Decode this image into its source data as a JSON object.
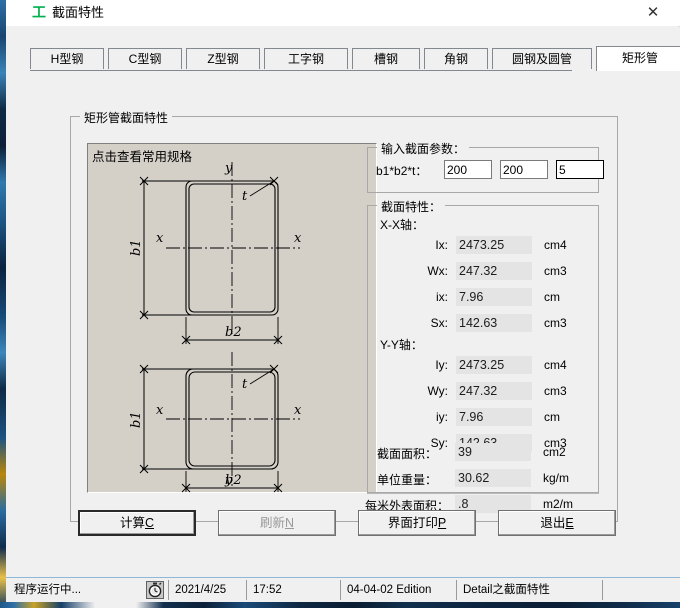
{
  "window": {
    "title": "截面特性",
    "icon": "ibeam-icon",
    "close_label": "✕"
  },
  "tabs": [
    {
      "label": "H型钢",
      "selected": false
    },
    {
      "label": "C型钢",
      "selected": false
    },
    {
      "label": "Z型钢",
      "selected": false
    },
    {
      "label": "工字钢",
      "selected": false
    },
    {
      "label": "槽钢",
      "selected": false
    },
    {
      "label": "角钢",
      "selected": false
    },
    {
      "label": "圆钢及圆管",
      "selected": false
    },
    {
      "label": "矩形管",
      "selected": true
    }
  ],
  "main_group": {
    "label": "矩形管截面特性"
  },
  "figure": {
    "hint": "点击查看常用规格",
    "labels": {
      "y": "y",
      "x": "x",
      "b1": "b1",
      "b2": "b2",
      "t": "t"
    }
  },
  "input_group": {
    "label": "输入截面参数：",
    "field_label": "b1*b2*t：",
    "fields": [
      {
        "name": "b1",
        "value": "200",
        "focused": false
      },
      {
        "name": "b2",
        "value": "200",
        "focused": false
      },
      {
        "name": "t",
        "value": "5",
        "focused": true
      }
    ]
  },
  "properties_group": {
    "label": "截面特性：",
    "xx_axis_label": "X-X轴：",
    "yy_axis_label": "Y-Y轴：",
    "xx_rows": [
      {
        "name": "Ix:",
        "value": "2473.25",
        "unit": "cm4"
      },
      {
        "name": "Wx:",
        "value": "247.32",
        "unit": "cm3"
      },
      {
        "name": "ix:",
        "value": "7.96",
        "unit": "cm"
      },
      {
        "name": "Sx:",
        "value": "142.63",
        "unit": "cm3"
      }
    ],
    "yy_rows": [
      {
        "name": "Iy:",
        "value": "2473.25",
        "unit": "cm4"
      },
      {
        "name": "Wy:",
        "value": "247.32",
        "unit": "cm3"
      },
      {
        "name": "iy:",
        "value": "7.96",
        "unit": "cm"
      },
      {
        "name": "Sy:",
        "value": "142.63",
        "unit": "cm3"
      }
    ],
    "summary_rows": [
      {
        "name": "截面面积：",
        "value": "39",
        "unit": "cm2"
      },
      {
        "name": "单位重量：",
        "value": "30.62",
        "unit": "kg/m"
      },
      {
        "name": "每米外表面积：",
        "value": ".8",
        "unit": "m2/m"
      }
    ]
  },
  "buttons": [
    {
      "name": "calculate",
      "label_pre": "计算",
      "accel": "C",
      "state": "default"
    },
    {
      "name": "refresh",
      "label_pre": "刷新",
      "accel": "N",
      "state": "disabled"
    },
    {
      "name": "print",
      "label_pre": "界面打印",
      "accel": "P",
      "state": "normal"
    },
    {
      "name": "exit",
      "label_pre": "退出",
      "accel": "E",
      "state": "normal"
    }
  ],
  "statusbar": {
    "cells": [
      "程序运行中...",
      "2021/4/25",
      "17:52",
      "04-04-02 Edition",
      "Detail之截面特性",
      ""
    ],
    "clock_icon": "stopwatch-icon"
  },
  "colors": {
    "dialog_bg": "#f0f0f0",
    "figure_bg": "#d4d0c8",
    "value_bg": "#e4e4e4",
    "tab_border": "#828790",
    "title_icon": "#00b050"
  }
}
